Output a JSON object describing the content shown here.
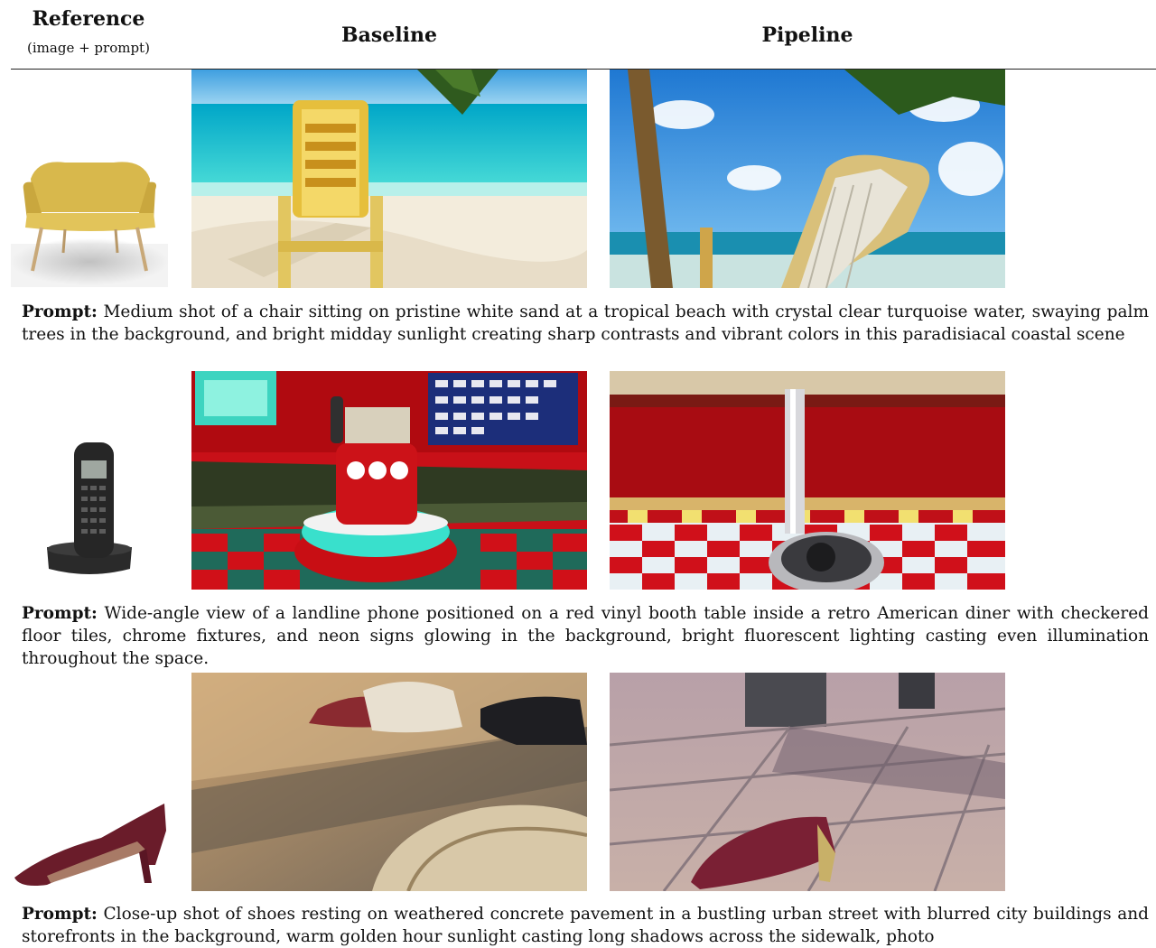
{
  "header": {
    "reference_title": "Reference",
    "reference_subtitle": "(image + prompt)",
    "baseline_title": "Baseline",
    "pipeline_title": "Pipeline"
  },
  "prompt_label": "Prompt:",
  "rows": [
    {
      "prompt": "Medium shot of a chair sitting on pristine white sand at a tropical beach with crystal clear turquoise water, swaying palm trees in the background, and bright midday sunlight creating sharp contrasts and vibrant colors in this paradisiacal coastal scene"
    },
    {
      "prompt": "Wide-angle view of a landline phone positioned on a red vinyl booth table inside a retro American diner with checkered floor tiles, chrome fixtures, and neon signs glowing in the background, bright fluorescent lighting casting even illumination throughout the space."
    },
    {
      "prompt": "Close-up shot of shoes resting on weathered concrete pavement in a bustling urban street with blurred city buildings and storefronts in the background, warm golden hour sunlight casting long shadows across the sidewalk, photo"
    }
  ]
}
